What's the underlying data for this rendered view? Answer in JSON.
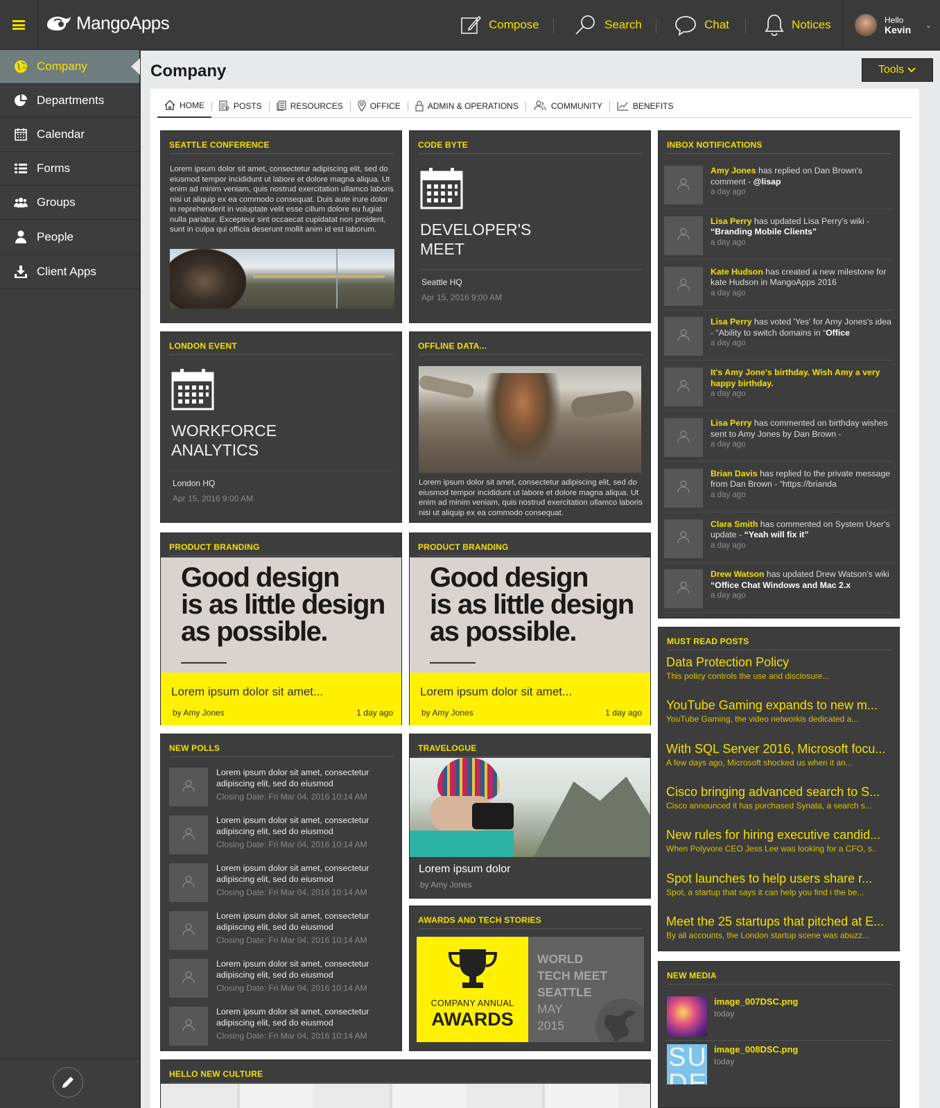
{
  "app": {
    "name": "MangoApps"
  },
  "topnav": {
    "compose": "Compose",
    "search": "Search",
    "chat": "Chat",
    "notices": "Notices",
    "hello": "Hello",
    "user": "Kevin"
  },
  "sidebar": {
    "items": [
      {
        "label": "Company",
        "icon": "globe-icon"
      },
      {
        "label": "Departments",
        "icon": "pie-chart-icon"
      },
      {
        "label": "Calendar",
        "icon": "calendar-icon"
      },
      {
        "label": "Forms",
        "icon": "list-icon"
      },
      {
        "label": "Groups",
        "icon": "group-icon"
      },
      {
        "label": "People",
        "icon": "person-icon"
      },
      {
        "label": "Client Apps",
        "icon": "download-icon"
      }
    ]
  },
  "page": {
    "title": "Company",
    "tools": "Tools"
  },
  "tabs": [
    "HOME",
    "POSTS",
    "RESOURCES",
    "OFFICE",
    "ADMIN & OPERATIONS",
    "COMMUNITY",
    "BENEFITS"
  ],
  "cards": {
    "seattle": {
      "header": "SEATTLE CONFERENCE",
      "body": "Lorem ipsum dolor sit amet, consectetur adipiscing elit, sed do eiusmod tempor incididunt ut labore et dolore magna aliqua. Ut enim ad minim veniam, quis nostrud exercitation ullamco laboris nisi ut aliquip ex ea commodo consequat. Duis aute irure dolor in reprehenderit in voluptate velit esse cillum dolore eu fugiat nulla pariatur. Excepteur sint occaecat cupidatat non proident, sunt in culpa qui officia deserunt mollit anim id est laborum."
    },
    "codebyte": {
      "header": "CODE BYTE",
      "title1": "DEVELOPER'S",
      "title2": "MEET",
      "location": "Seattle HQ",
      "date": "Apr 15, 2016 9:00 AM"
    },
    "london": {
      "header": "LONDON EVENT",
      "title1": "WORKFORCE",
      "title2": "ANALYTICS",
      "location": "London HQ",
      "date": "Apr 15, 2016 9:00 AM"
    },
    "offline": {
      "header": "OFFLINE DATA...",
      "body": "Lorem ipsum dolor sit amet, consectetur adipiscing elit, sed do eiusmod tempor incididunt ut labore et dolore magna aliqua. Ut enim ad minim veniam, quis nostrud exercitation ullamco laboris nisi ut aliquip ex ea commodo consequat."
    },
    "branding": {
      "header": "PRODUCT BRANDING",
      "line1": "Good design",
      "line2": "is as little design",
      "line3": "as possible.",
      "title": "Lorem ipsum dolor sit amet...",
      "by": "by Amy Jones",
      "ago": "1 day ago"
    },
    "polls": {
      "header": "NEW POLLS",
      "items": [
        {
          "line1": "Lorem ipsum dolor sit amet, consectetur",
          "line2": "adipiscing elit, sed do eiusmod",
          "date": "Closing Date: Fri Mar 04, 2016 10:14 AM"
        },
        {
          "line1": "Lorem ipsum dolor sit amet, consectetur",
          "line2": "adipiscing elit, sed do eiusmod",
          "date": "Closing Date: Fri Mar 04, 2016 10:14 AM"
        },
        {
          "line1": "Lorem ipsum dolor sit amet, consectetur",
          "line2": "adipiscing elit, sed do eiusmod",
          "date": "Closing Date: Fri Mar 04, 2016 10:14 AM"
        },
        {
          "line1": "Lorem ipsum dolor sit amet, consectetur",
          "line2": "adipiscing elit, sed do eiusmod",
          "date": "Closing Date: Fri Mar 04, 2016 10:14 AM"
        },
        {
          "line1": "Lorem ipsum dolor sit amet, consectetur",
          "line2": "adipiscing elit, sed do eiusmod",
          "date": "Closing Date: Fri Mar 04, 2016 10:14 AM"
        },
        {
          "line1": "Lorem ipsum dolor sit amet, consectetur",
          "line2": "adipiscing elit, sed do eiusmod",
          "date": "Closing Date: Fri Mar 04, 2016 10:14 AM"
        }
      ]
    },
    "travel": {
      "header": "TRAVELOGUE",
      "title": "Lorem ipsum dolor",
      "by": "by Amy Jones"
    },
    "awards": {
      "header": "AWARDS AND TECH STORIES",
      "left1": "COMPANY ANNUAL",
      "left2": "AWARDS",
      "r1": "WORLD",
      "r2": "TECH MEET",
      "r3": "SEATTLE",
      "r4": "MAY",
      "r5": "2015"
    },
    "culture": {
      "header": "HELLO NEW CULTURE"
    },
    "inbox": {
      "header": "INBOX NOTIFICATIONS",
      "items": [
        {
          "name": "Amy Jones",
          "text": " has replied on Dan Brown's comment - ",
          "tail": "@lisap",
          "when": "a day ago"
        },
        {
          "name": "Lisa Perry",
          "text": " has updated Lisa Perry's wiki - ",
          "tail": "“Branding Mobile Clients”",
          "when": "a day ago"
        },
        {
          "name": "Kate Hudson",
          "text": " has created a new milestone for kate Hudson in MangoApps 2016",
          "tail": "",
          "when": "a day ago"
        },
        {
          "name": "Lisa Perry",
          "text": " has voted 'Yes' for Amy Jones's idea - “Ability to switch domains in “",
          "tail": "Office",
          "when": "a day ago"
        },
        {
          "name": "It's Amy Jone's birthday. Wish Amy a very happy birthday.",
          "text": "",
          "tail": "",
          "when": "a day ago"
        },
        {
          "name": "Lisa Perry",
          "text": " has commented on birthday wishes sent to Amy Jones by Dan Brown -",
          "tail": "",
          "when": "a day ago"
        },
        {
          "name": "Brian Davis",
          "text": " has replied to the private message from Dan Brown - “https://brianda",
          "tail": "",
          "when": "a day ago"
        },
        {
          "name": "Clara Smith",
          "text": " has commented on System User's update - ",
          "tail": "“Yeah will fix it”",
          "when": "a day ago"
        },
        {
          "name": "Drew Watson",
          "text": " has updated Drew Watson's wiki ",
          "tail": "“Office Chat Windows and Mac 2.x",
          "when": "a day ago"
        }
      ]
    },
    "mustread": {
      "header": "MUST READ POSTS",
      "items": [
        {
          "title": "Data Protection Policy",
          "sub": "This policy controls the use and disclosure..."
        },
        {
          "title": "YouTube Gaming expands to new m...",
          "sub": "YouTube Gaming, the video networkis dedicated a..."
        },
        {
          "title": "With SQL Server 2016, Microsoft focu...",
          "sub": "A few days ago, Microsoft shocked us when it an..."
        },
        {
          "title": "Cisco bringing advanced search to S...",
          "sub": "Cisco announced it has purchased Synata, a search s..."
        },
        {
          "title": "New rules for hiring executive candid...",
          "sub": "When Polyvore CEO Jess Lee was looking for a CFO, s.."
        },
        {
          "title": "Spot launches to help users share r...",
          "sub": "Spot, a startup that says it can help you find i the be..."
        },
        {
          "title": "Meet the 25 startups that pitched at E...",
          "sub": "By all accounts, the London startup scene was abuzz..."
        }
      ]
    },
    "media": {
      "header": "NEW MEDIA",
      "items": [
        {
          "name": "image_007DSC.png",
          "when": "today"
        },
        {
          "name": "image_008DSC.png",
          "when": "today"
        }
      ]
    }
  },
  "colors": {
    "accent": "#f2e000",
    "panel": "#3d3d3d",
    "bg": "#e8e9eb"
  }
}
